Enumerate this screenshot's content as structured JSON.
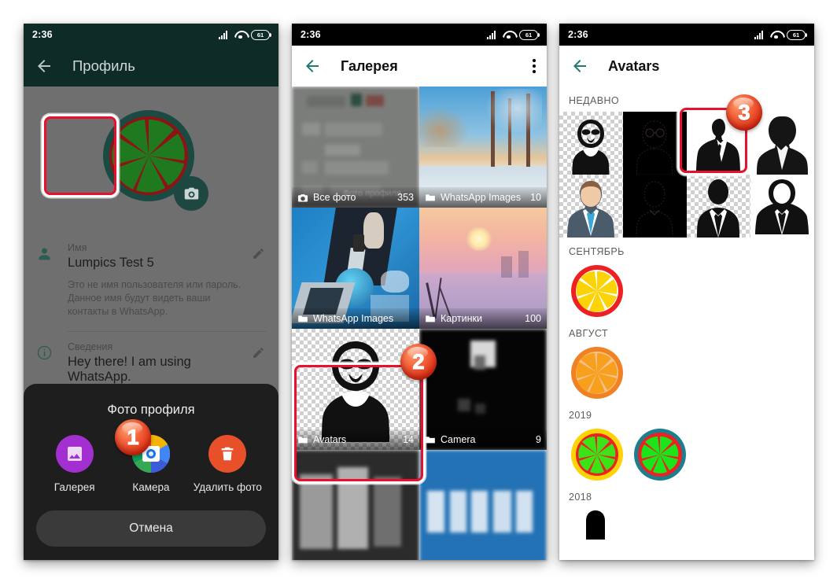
{
  "status_bar": {
    "time": "2:36",
    "battery": "61"
  },
  "panel1": {
    "appbar": {
      "title": "Профиль",
      "back_icon": "back-arrow-icon"
    },
    "avatar": {
      "icon": "lemon-slice-avatar",
      "camera_icon": "camera-icon"
    },
    "fields": [
      {
        "icon": "person-icon",
        "label": "Имя",
        "value": "Lumpics Test 5",
        "hint": "Это не имя пользователя или пароль. Данное имя будут видеть ваши контакты в WhatsApp.",
        "edit_icon": "pencil-icon"
      },
      {
        "icon": "info-icon",
        "label": "Сведения",
        "value": "Hey there! I am using WhatsApp.",
        "hint": "",
        "edit_icon": "pencil-icon"
      },
      {
        "icon": "phone-icon",
        "label": "",
        "value": "",
        "hint": "",
        "edit_icon": ""
      }
    ],
    "sheet": {
      "title": "Фото профиля",
      "actions": [
        {
          "label": "Галерея",
          "icon": "gallery-icon",
          "color": "#a32fd0"
        },
        {
          "label": "Камера",
          "icon": "camera-color-icon",
          "color": "#4285f4"
        },
        {
          "label": "Удалить фото",
          "icon": "trash-icon",
          "color": "#e8502a"
        }
      ],
      "cancel_label": "Отмена"
    }
  },
  "panel2": {
    "appbar": {
      "title": "Галерея",
      "back_icon": "back-arrow-icon",
      "menu_icon": "kebab-menu-icon"
    },
    "albums": [
      {
        "name": "Все фото",
        "count": "353",
        "icon": "camera-icon",
        "overlay_text": "Фото профиля"
      },
      {
        "name": "WhatsApp Images",
        "count": "10",
        "icon": "folder-icon",
        "overlay_text": ""
      },
      {
        "name": "WhatsApp Images",
        "count": "",
        "icon": "folder-icon",
        "overlay_text": ""
      },
      {
        "name": "Картинки",
        "count": "100",
        "icon": "folder-icon",
        "overlay_text": ""
      },
      {
        "name": "Avatars",
        "count": "14",
        "icon": "folder-icon",
        "overlay_text": ""
      },
      {
        "name": "Camera",
        "count": "9",
        "icon": "folder-icon",
        "overlay_text": ""
      },
      {
        "name": "",
        "count": "",
        "icon": "",
        "overlay_text": ""
      },
      {
        "name": "",
        "count": "",
        "icon": "",
        "overlay_text": ""
      }
    ]
  },
  "panel3": {
    "appbar": {
      "title": "Avatars",
      "back_icon": "back-arrow-icon"
    },
    "sections": [
      {
        "heading": "НЕДАВНО",
        "type": "grid",
        "items": 8
      },
      {
        "heading": "СЕНТЯБРЬ",
        "type": "row",
        "items": 1
      },
      {
        "heading": "АВГУСТ",
        "type": "row",
        "items": 1
      },
      {
        "heading": "2019",
        "type": "row",
        "items": 2
      },
      {
        "heading": "2018",
        "type": "row",
        "items": 1
      }
    ]
  },
  "annotations": {
    "steps": [
      {
        "number": "1",
        "target": "gallery-action-button"
      },
      {
        "number": "2",
        "target": "avatars-album-cell"
      },
      {
        "number": "3",
        "target": "avatar-thumb-3"
      }
    ],
    "highlight_color": "#e8112d"
  }
}
